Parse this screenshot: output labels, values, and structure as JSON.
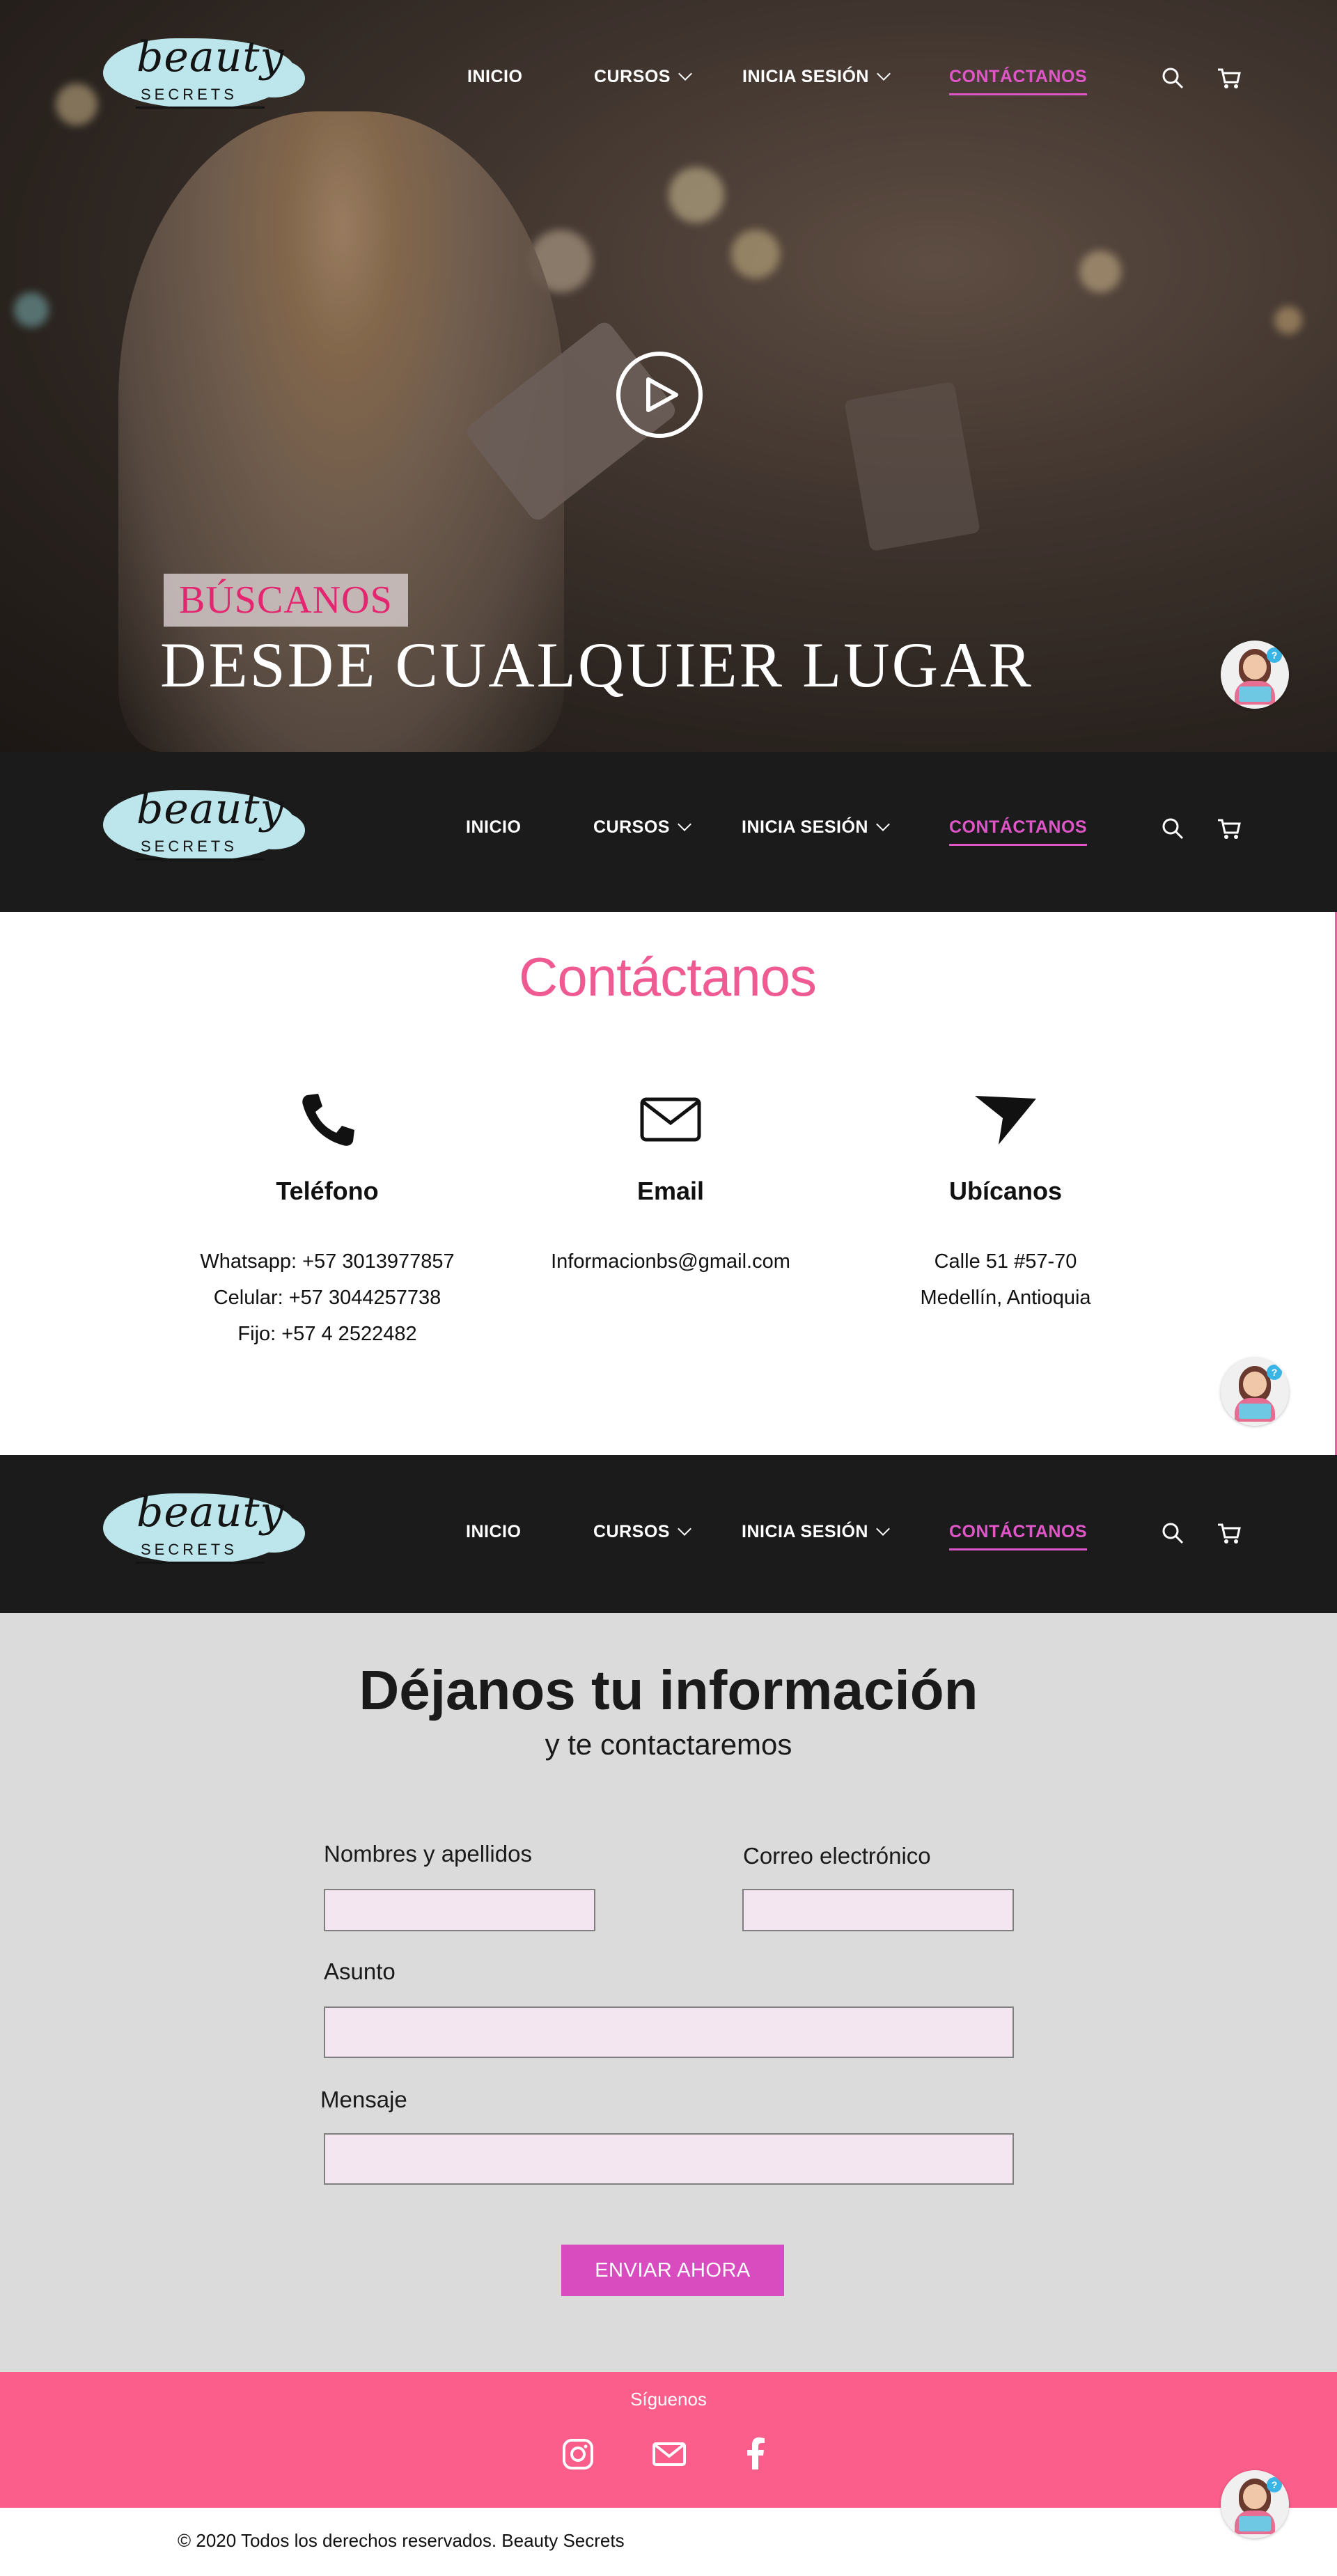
{
  "brand": {
    "logo_word": "beauty",
    "logo_sub": "SECRETS"
  },
  "nav": {
    "items": [
      {
        "label": "INICIO"
      },
      {
        "label": "CURSOS"
      },
      {
        "label": "INICIA SESIÓN"
      },
      {
        "label": "CONTÁCTANOS",
        "active": true
      }
    ],
    "icons": [
      "search-icon",
      "cart-icon"
    ]
  },
  "hero": {
    "tag": "BÚSCANOS",
    "title": "DESDE CUALQUIER LUGAR"
  },
  "contact": {
    "title": "Contáctanos",
    "columns": [
      {
        "icon": "phone-icon",
        "title": "Teléfono",
        "lines": [
          "Whatsapp: +57 3013977857",
          "Celular: +57 3044257738",
          "Fijo: +57 4 2522482"
        ]
      },
      {
        "icon": "mail-icon",
        "title": "Email",
        "lines": [
          "Informacionbs@gmail.com"
        ]
      },
      {
        "icon": "location-arrow-icon",
        "title": "Ubícanos",
        "lines": [
          "Calle 51 #57-70",
          "Medellín, Antioquia"
        ]
      }
    ]
  },
  "form": {
    "title": "Déjanos tu información",
    "subtitle": "y te contactaremos",
    "name_label": "Nombres y apellidos",
    "email_label": "Correo electrónico",
    "subject_label": "Asunto",
    "message_label": "Mensaje",
    "submit_label": "ENVIAR AHORA"
  },
  "footer": {
    "follow_label": "Síguenos",
    "social": [
      "instagram-icon",
      "mail-icon",
      "facebook-icon"
    ],
    "copyright": "© 2020 Todos los derechos reservados. Beauty Secrets"
  },
  "chat": {
    "badge": "?"
  },
  "colors": {
    "accent_pink": "#f05a92",
    "nav_active": "#e056c8",
    "button": "#d94cc0",
    "footer": "#fb5e8b",
    "logo_swash": "#bde6ec",
    "dark_bar": "#1b1b1b"
  }
}
